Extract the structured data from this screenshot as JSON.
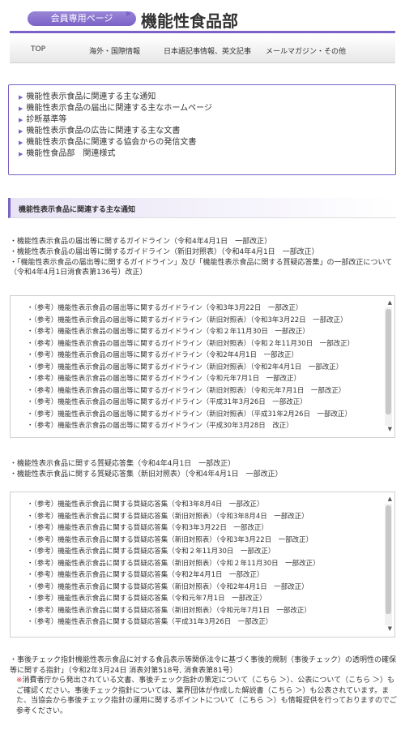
{
  "header": {
    "badge_label": "会員専用ページ",
    "badge_arrow": "▶",
    "title": "機能性食品部"
  },
  "nav": {
    "items": [
      {
        "label": "TOP"
      },
      {
        "label": "海外・国際情報"
      },
      {
        "label": "日本語記事情報、英文記事"
      },
      {
        "label": "メールマガジン・その他"
      }
    ]
  },
  "links": {
    "caret": "▶",
    "items": [
      {
        "label": "機能性表示食品に関連する主な通知"
      },
      {
        "label": "機能性表示食品の届出に関連する主なホームページ"
      },
      {
        "label": "診断基準等"
      },
      {
        "label": "機能性表示食品の広告に関連する主な文書"
      },
      {
        "label": "機能性表示食品に関連する協会からの発信文書"
      },
      {
        "label": "機能性食品部　関連様式"
      }
    ]
  },
  "section": {
    "heading": "機能性表示食品に関連する主な通知"
  },
  "guidelines": {
    "bullets": [
      {
        "text": "・機能性表示食品の届出等に関するガイドライン（令和4年4月1日　一部改正）"
      },
      {
        "text": "・機能性表示食品の届出等に関するガイドライン（新旧対照表）（令和4年4月1日　一部改正）"
      },
      {
        "text": "・「機能性表示食品の届出等に関するガイドライン」及び「機能性表示食品に関する質疑応答集」の一部改正について（令和4年4月1日消食表第136号）改正）"
      }
    ],
    "scroll_lines": [
      {
        "text": "・（参考）機能性表示食品の届出等に関するガイドライン（令和3年3月22日　一部改正）"
      },
      {
        "text": "・（参考）機能性表示食品の届出等に関するガイドライン（新旧対照表）（令和3年3月22日　一部改正）"
      },
      {
        "text": "・（参考）機能性表示食品の届出等に関するガイドライン（令和２年11月30日　一部改正）"
      },
      {
        "text": "・（参考）機能性表示食品の届出等に関するガイドライン（新旧対照表）（令和２年11月30日　一部改正）"
      },
      {
        "text": "・（参考）機能性表示食品の届出等に関するガイドライン（令和2年4月1日　一部改正）"
      },
      {
        "text": "・（参考）機能性表示食品の届出等に関するガイドライン（新旧対照表）（令和2年4月1日　一部改正）"
      },
      {
        "text": "・（参考）機能性表示食品の届出等に関するガイドライン（令和元年7月1日　一部改正）"
      },
      {
        "text": "・（参考）機能性表示食品の届出等に関するガイドライン（新旧対照表）（令和元年7月1日　一部改正）"
      },
      {
        "text": "・（参考）機能性表示食品の届出等に関するガイドライン（平成31年3月26日　一部改正）"
      },
      {
        "text": "・（参考）機能性表示食品の届出等に関するガイドライン（新旧対照表）（平成31年2月26日　一部改正）"
      },
      {
        "text": "・（参考）機能性表示食品の届出等に関するガイドライン（平成30年3月28日　改正）"
      }
    ]
  },
  "qa": {
    "bullets": [
      {
        "text": "・機能性表示食品に関する質疑応答集（令和4年4月1日　一部改正）"
      },
      {
        "text": "・機能性表示食品に関する質疑応答集（新旧対照表）（令和4年4月1日　一部改正）"
      }
    ],
    "scroll_lines": [
      {
        "text": "・（参考）機能性表示食品に関する質疑応答集（令和3年8月4日　一部改正）"
      },
      {
        "text": "・（参考）機能性表示食品に関する質疑応答集（新旧対照表）（令和3年8月4日　一部改正）"
      },
      {
        "text": "・（参考）機能性表示食品に関する質疑応答集（令和3年3月22日　一部改正）"
      },
      {
        "text": "・（参考）機能性表示食品に関する質疑応答集（新旧対照表）（令和3年3月22日　一部改正）"
      },
      {
        "text": "・（参考）機能性表示食品に関する質疑応答集（令和２年11月30日　一部改正）"
      },
      {
        "text": "・（参考）機能性表示食品に関する質疑応答集（新旧対照表）（令和２年11月30日　一部改正）"
      },
      {
        "text": "・（参考）機能性表示食品に関する質疑応答集（令和2年4月1日　一部改正）"
      },
      {
        "text": "・（参考）機能性表示食品に関する質疑応答集（新旧対照表）（令和2年4月1日　一部改正）"
      },
      {
        "text": "・（参考）機能性表示食品に関する質疑応答集（令和元年7月1日　一部改正）"
      },
      {
        "text": "・（参考）機能性表示食品に関する質疑応答集（新旧対照表）（令和元年7月1日　一部改正）"
      },
      {
        "text": "・（参考）機能性表示食品に関する質疑応答集（平成31年3月26日　一部改正）"
      }
    ]
  },
  "scrollbar": {
    "up": "▲",
    "down": "▼"
  },
  "footer": {
    "main": "・事後チェック指針機能性表示食品に対する食品表示等関係法令に基づく事後的規制（事後チェック）の透明性の確保等に関する指針」（令和2年3月24日 消表対第518号, 消食表第81号）",
    "note_mark": "※",
    "note": "消費者庁から発出されている文書、事後チェック指針の策定について（こちら ＞）、公表について（こちら ＞）もご確認ください。事後チェック指針については、業界団体が作成した解説書（こちら ＞）も公表されています。また、当協会から事後チェック指針の運用に関するポイントについて（こちら ＞）も情報提供を行っておりますのでご参考ください。"
  }
}
